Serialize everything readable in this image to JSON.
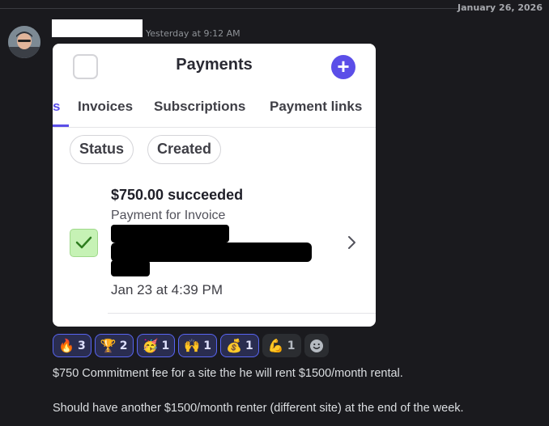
{
  "date_divider": "January 26, 2026",
  "message": {
    "timestamp": "Yesterday at 9:12 AM",
    "lines": [
      "$750 Commitment fee for a site the he will rent $1500/month rental.",
      "Should have another $1500/month renter (different site) at the end of the week."
    ]
  },
  "attachment": {
    "title": "Payments",
    "tabs": [
      "s",
      "Invoices",
      "Subscriptions",
      "Payment links"
    ],
    "active_tab": "s",
    "filters": [
      "Status",
      "Created"
    ],
    "payment": {
      "amount_status": "$750.00 succeeded",
      "subtitle": "Payment for Invoice",
      "date": "Jan 23 at 4:39 PM"
    },
    "accent_color": "#5b4ee8"
  },
  "reactions": [
    {
      "emoji": "fire-emoji",
      "glyph": "🔥",
      "count": "3"
    },
    {
      "emoji": "trophy-emoji",
      "glyph": "🏆",
      "count": "2"
    },
    {
      "emoji": "party-face-emoji",
      "glyph": "🥳",
      "count": "1"
    },
    {
      "emoji": "raised-hands-emoji",
      "glyph": "🙌",
      "count": "1"
    },
    {
      "emoji": "money-bag-emoji",
      "glyph": "💰",
      "count": "1"
    },
    {
      "emoji": "flexed-biceps-emoji",
      "glyph": "💪",
      "count": "1"
    }
  ]
}
